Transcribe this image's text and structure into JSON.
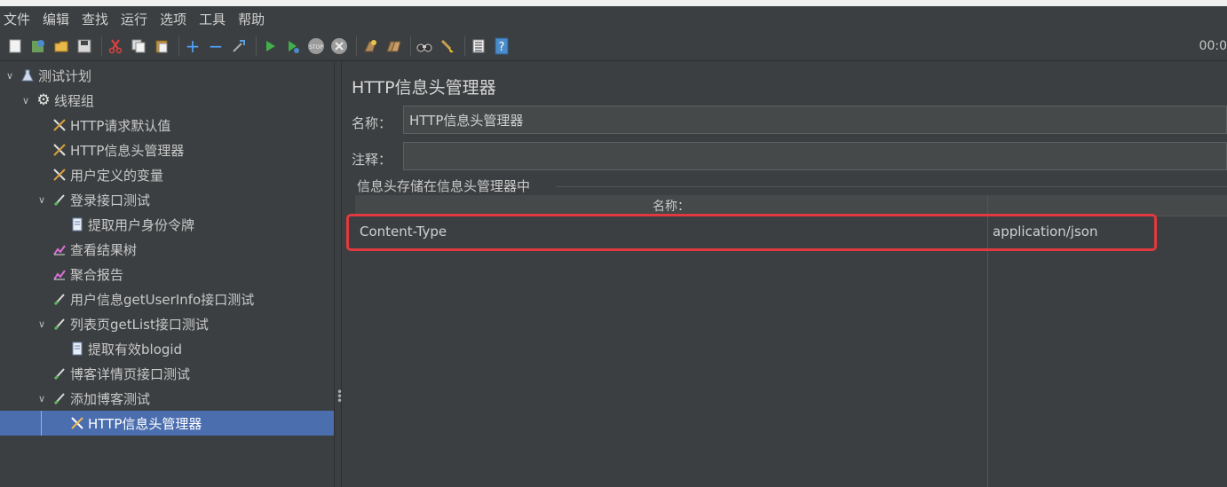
{
  "menubar": [
    "文件",
    "编辑",
    "查找",
    "运行",
    "选项",
    "工具",
    "帮助"
  ],
  "toolbar": {
    "icons": [
      "new-icon",
      "templates-icon",
      "open-icon",
      "save-icon",
      "cut-icon",
      "copy-icon",
      "paste-icon",
      "expand-icon",
      "collapse-icon",
      "toggle-icon",
      "start-icon",
      "start-no-pauses-icon",
      "stop-icon",
      "shutdown-icon",
      "clear-icon",
      "clear-all-icon",
      "search-icon",
      "reset-search-icon",
      "function-helper-icon",
      "help-icon"
    ],
    "timer": "00:0"
  },
  "tree": [
    {
      "label": "测试计划",
      "icon": "flask-icon",
      "expanded": true
    },
    {
      "label": "线程组",
      "icon": "gear-icon",
      "expanded": true
    },
    {
      "label": "HTTP请求默认值",
      "icon": "wrench-icon"
    },
    {
      "label": "HTTP信息头管理器",
      "icon": "wrench-icon"
    },
    {
      "label": "用户定义的变量",
      "icon": "wrench-icon"
    },
    {
      "label": "登录接口测试",
      "icon": "pipette-icon",
      "expanded": true
    },
    {
      "label": "提取用户身份令牌",
      "icon": "document-icon"
    },
    {
      "label": "查看结果树",
      "icon": "chart-icon"
    },
    {
      "label": "聚合报告",
      "icon": "chart-icon"
    },
    {
      "label": "用户信息getUserInfo接口测试",
      "icon": "pipette-icon"
    },
    {
      "label": "列表页getList接口测试",
      "icon": "pipette-icon",
      "expanded": true
    },
    {
      "label": "提取有效blogid",
      "icon": "document-icon"
    },
    {
      "label": "博客详情页接口测试",
      "icon": "pipette-icon"
    },
    {
      "label": "添加博客测试",
      "icon": "pipette-icon",
      "expanded": true
    },
    {
      "label": "HTTP信息头管理器",
      "icon": "wrench-icon",
      "selected": true
    }
  ],
  "panel": {
    "title": "HTTP信息头管理器",
    "name_label": "名称：",
    "name_value": "HTTP信息头管理器",
    "comment_label": "注释：",
    "comment_value": "",
    "group_title": "信息头存储在信息头管理器中",
    "table": {
      "headers": [
        "名称：",
        ""
      ],
      "rows": [
        [
          "Content-Type",
          "application/json"
        ]
      ]
    }
  },
  "colors": {
    "background": "#3c3f41",
    "selection": "#4b6eaf",
    "highlight_border": "#e0393e"
  }
}
